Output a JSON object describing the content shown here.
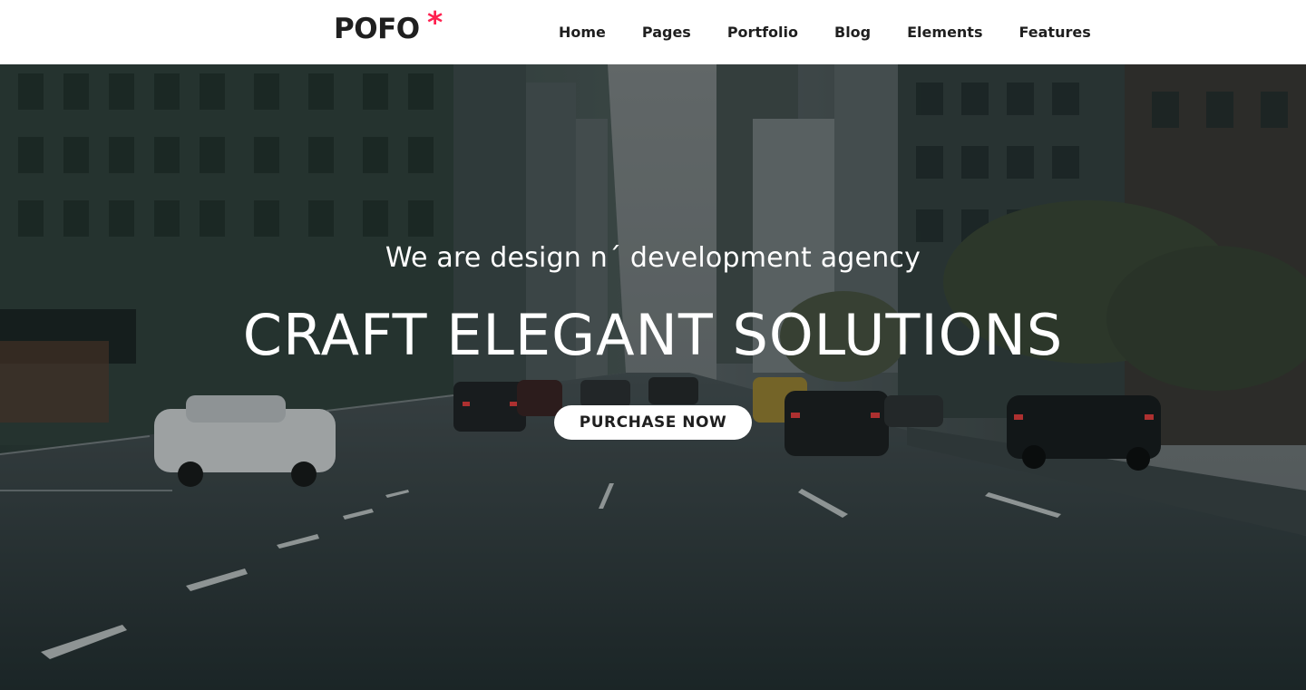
{
  "header": {
    "logo_text": "POFO",
    "logo_mark": "*",
    "nav": [
      {
        "label": "Home"
      },
      {
        "label": "Pages"
      },
      {
        "label": "Portfolio"
      },
      {
        "label": "Blog"
      },
      {
        "label": "Elements"
      },
      {
        "label": "Features"
      }
    ]
  },
  "hero": {
    "subtitle": "We are design n´ development agency",
    "title": "CRAFT ELEGANT SOLUTIONS",
    "button_label": "PURCHASE NOW"
  },
  "colors": {
    "accent": "#ff214f",
    "text_dark": "#1f1f1f",
    "header_bg": "#ffffff",
    "hero_overlay": "#141c1e"
  }
}
